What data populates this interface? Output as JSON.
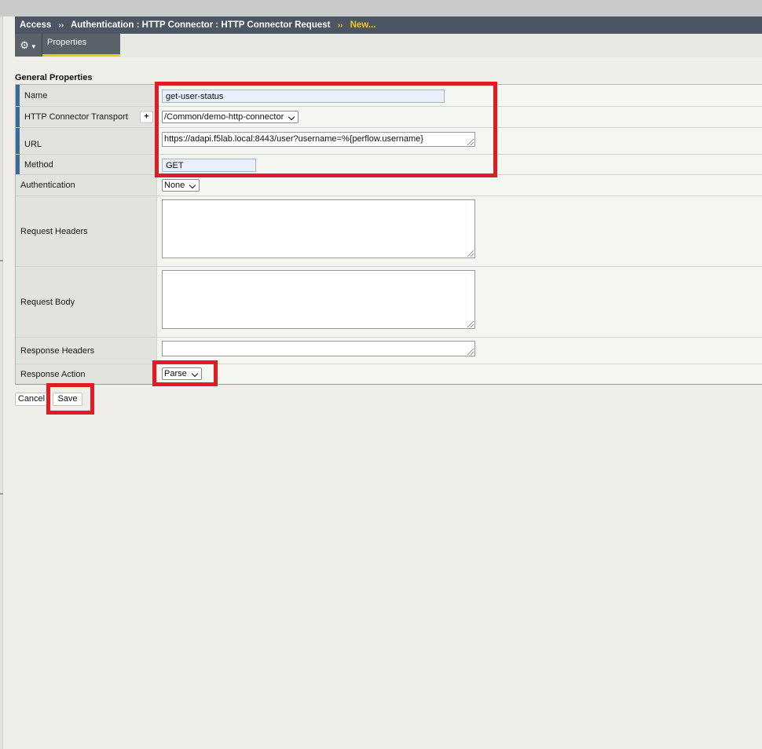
{
  "breadcrumb": {
    "items": [
      "Access",
      "Authentication : HTTP Connector : HTTP Connector Request"
    ],
    "separator": "››",
    "current": "New..."
  },
  "tabs": {
    "gear_icon": "gear-icon",
    "properties_label": "Properties"
  },
  "section": {
    "title": "General Properties"
  },
  "form": {
    "name": {
      "label": "Name",
      "value": "get-user-status"
    },
    "transport": {
      "label": "HTTP Connector Transport",
      "add_label": "+",
      "selected": "/Common/demo-http-connector"
    },
    "url": {
      "label": "URL",
      "value": "https://adapi.f5lab.local:8443/user?username=%{perflow.username}"
    },
    "method": {
      "label": "Method",
      "value": "GET"
    },
    "authentication": {
      "label": "Authentication",
      "selected": "None"
    },
    "request_headers": {
      "label": "Request Headers",
      "value": ""
    },
    "request_body": {
      "label": "Request Body",
      "value": ""
    },
    "response_headers": {
      "label": "Response Headers",
      "value": ""
    },
    "response_action": {
      "label": "Response Action",
      "selected": "Parse"
    }
  },
  "buttons": {
    "cancel": "Cancel",
    "save": "Save"
  },
  "colors": {
    "header_bg": "#4b5563",
    "accent_yellow": "#f5c518",
    "required_bar": "#3e6a98",
    "highlight_red": "#e11b22"
  }
}
